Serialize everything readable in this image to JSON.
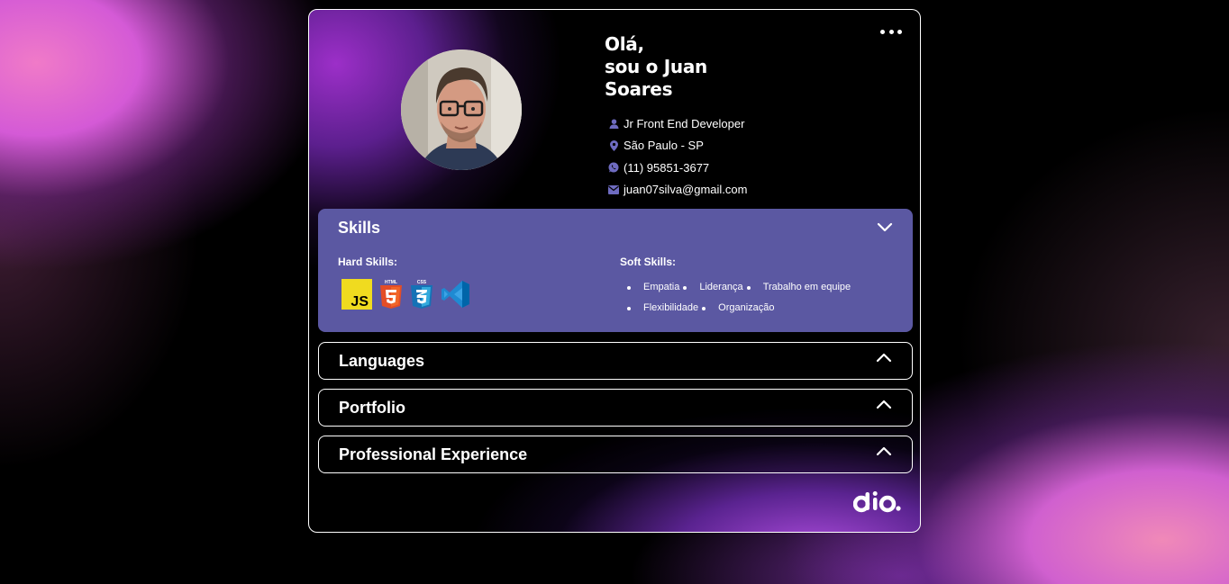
{
  "header": {
    "greeting_line1": "Olá,",
    "greeting_line2": "sou o Juan",
    "greeting_line3": "Soares",
    "menu_icon": "more-horizontal-icon"
  },
  "info": [
    {
      "icon": "user-icon",
      "text": "Jr Front End Developer"
    },
    {
      "icon": "location-pin-icon",
      "text": "São Paulo - SP"
    },
    {
      "icon": "whatsapp-icon",
      "text": "(11) 95851-3677"
    },
    {
      "icon": "mail-icon",
      "text": "juan07silva@gmail.com"
    }
  ],
  "skills": {
    "title": "Skills",
    "hard_title": "Hard Skills:",
    "hard_icons": [
      "javascript-icon",
      "html5-icon",
      "css3-icon",
      "vscode-icon"
    ],
    "html_badge": "HTML",
    "css_badge": "CSS",
    "js_label": "JS",
    "soft_title": "Soft Skills:",
    "soft_items": [
      "Empatia",
      "Liderança",
      "Trabalho em equipe",
      "Flexibilidade",
      "Organização"
    ],
    "expanded": true
  },
  "sections": [
    {
      "title": "Languages",
      "expanded": false
    },
    {
      "title": "Portfolio",
      "expanded": false
    },
    {
      "title": "Professional Experience",
      "expanded": false
    }
  ],
  "colors": {
    "accent": "#5b58a2",
    "icon_color": "#6e6bc0",
    "text": "#ffffff",
    "background": "#000000"
  },
  "footer_logo": "dio-logo"
}
